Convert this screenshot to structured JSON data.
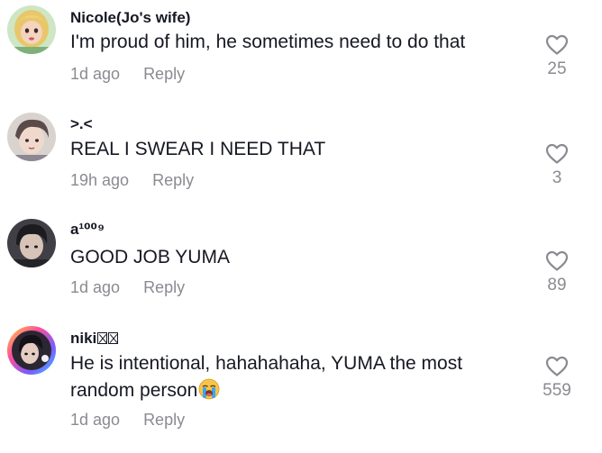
{
  "comments": [
    {
      "username": "Nicole(Jo's wife)",
      "text": "I'm proud of him, he sometimes need to do that",
      "time": "1d ago",
      "reply_label": "Reply",
      "likes": "25",
      "avatar_icon": "avatar-blonde-cartoon-girl"
    },
    {
      "username": ">.<",
      "text": "REAL I SWEAR I NEED THAT",
      "time": "19h ago",
      "reply_label": "Reply",
      "likes": "3",
      "avatar_icon": "avatar-anime-boy"
    },
    {
      "username": "a¹⁰⁰⁹",
      "text": "GOOD JOB YUMA",
      "time": "1d ago",
      "reply_label": "Reply",
      "likes": "89",
      "avatar_icon": "avatar-dark-hair-person"
    },
    {
      "username": "niki",
      "text": "He is intentional, hahahahaha, YUMA the most random person",
      "time": "1d ago",
      "reply_label": "Reply",
      "likes": "559",
      "avatar_icon": "avatar-rainbow-ring-person",
      "text_emoji": "loudly-crying-face-emoji"
    }
  ],
  "colors": {
    "primary_text": "#161823",
    "secondary_text": "#8a8b91",
    "heart_outline": "#8a8b91",
    "background": "#ffffff"
  }
}
